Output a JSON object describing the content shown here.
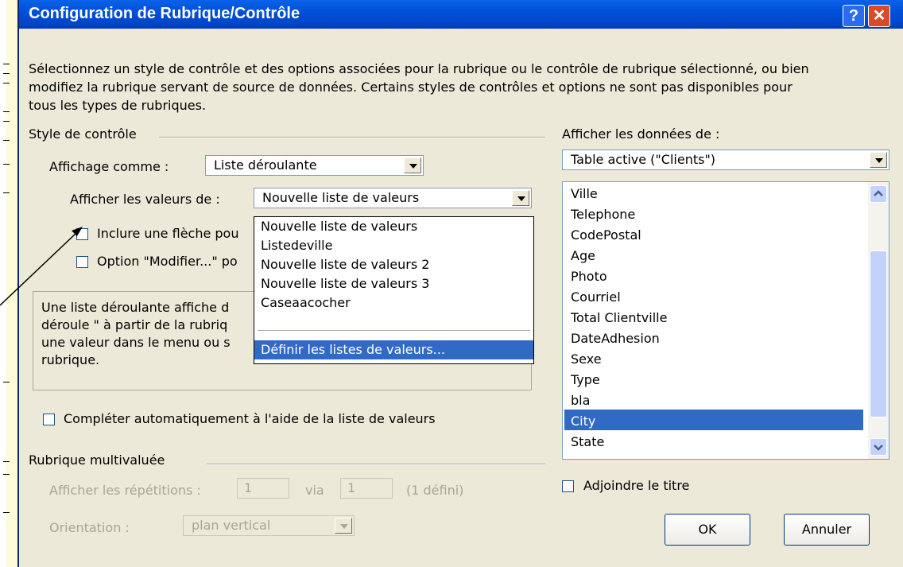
{
  "window": {
    "title": "Configuration de Rubrique/Contrôle",
    "help_label": "?",
    "close_label": "✕"
  },
  "intro_text": [
    "Sélectionnez un style de contrôle et des options associées pour la rubrique ou le contrôle de rubrique sélectionné, ou bien",
    "modifiez la rubrique servant de source de données. Certains styles de contrôles et options ne sont pas disponibles pour",
    "tous les types de rubriques."
  ],
  "control_style": {
    "group_label": "Style de contrôle",
    "display_as_label": "Affichage comme :",
    "display_as_value": "Liste déroulante",
    "values_from_label": "Afficher les valeurs de :",
    "values_from_value": "Nouvelle liste de valeurs",
    "checkbox_arrow_label": "Inclure une flèche pou",
    "checkbox_modify_label": "Option \"Modifier...\" po",
    "description": [
      "Une liste déroulante affiche d",
      "déroule \" à partir de la rubriq",
      "une valeur dans le menu ou s",
      "rubrique."
    ]
  },
  "value_list_dropdown": {
    "items": [
      "Nouvelle liste de valeurs",
      "Listedeville",
      "Nouvelle liste de valeurs 2",
      "Nouvelle liste de valeurs 3",
      "Caseaacocher"
    ],
    "define_item": "Définir les listes de valeurs..."
  },
  "autocomplete_label": "Compléter automatiquement à l'aide de la liste de valeurs",
  "multivalue": {
    "group_label": "Rubrique multivaluée",
    "repetitions_label": "Afficher les répétitions :",
    "repetitions_from": "1",
    "via_label": "via",
    "repetitions_to": "1",
    "defined_note": "(1 défini)",
    "orientation_label": "Orientation :",
    "orientation_value": "plan vertical"
  },
  "data_source": {
    "label": "Afficher les données de :",
    "table_value": "Table active (\"Clients\")",
    "fields": [
      "Ville",
      "Telephone",
      "CodePostal",
      "Age",
      "Photo",
      "Courriel",
      "Total Clientville",
      "DateAdhesion",
      "Sexe",
      "Type",
      "bla",
      "City",
      "State"
    ],
    "selected_field": "City",
    "add_title_label": "Adjoindre le titre"
  },
  "buttons": {
    "ok": "OK",
    "cancel": "Annuler"
  },
  "colors": {
    "title_bar": "#0050d8",
    "selection": "#316ac5",
    "dialog_bg": "#ece9d8"
  }
}
